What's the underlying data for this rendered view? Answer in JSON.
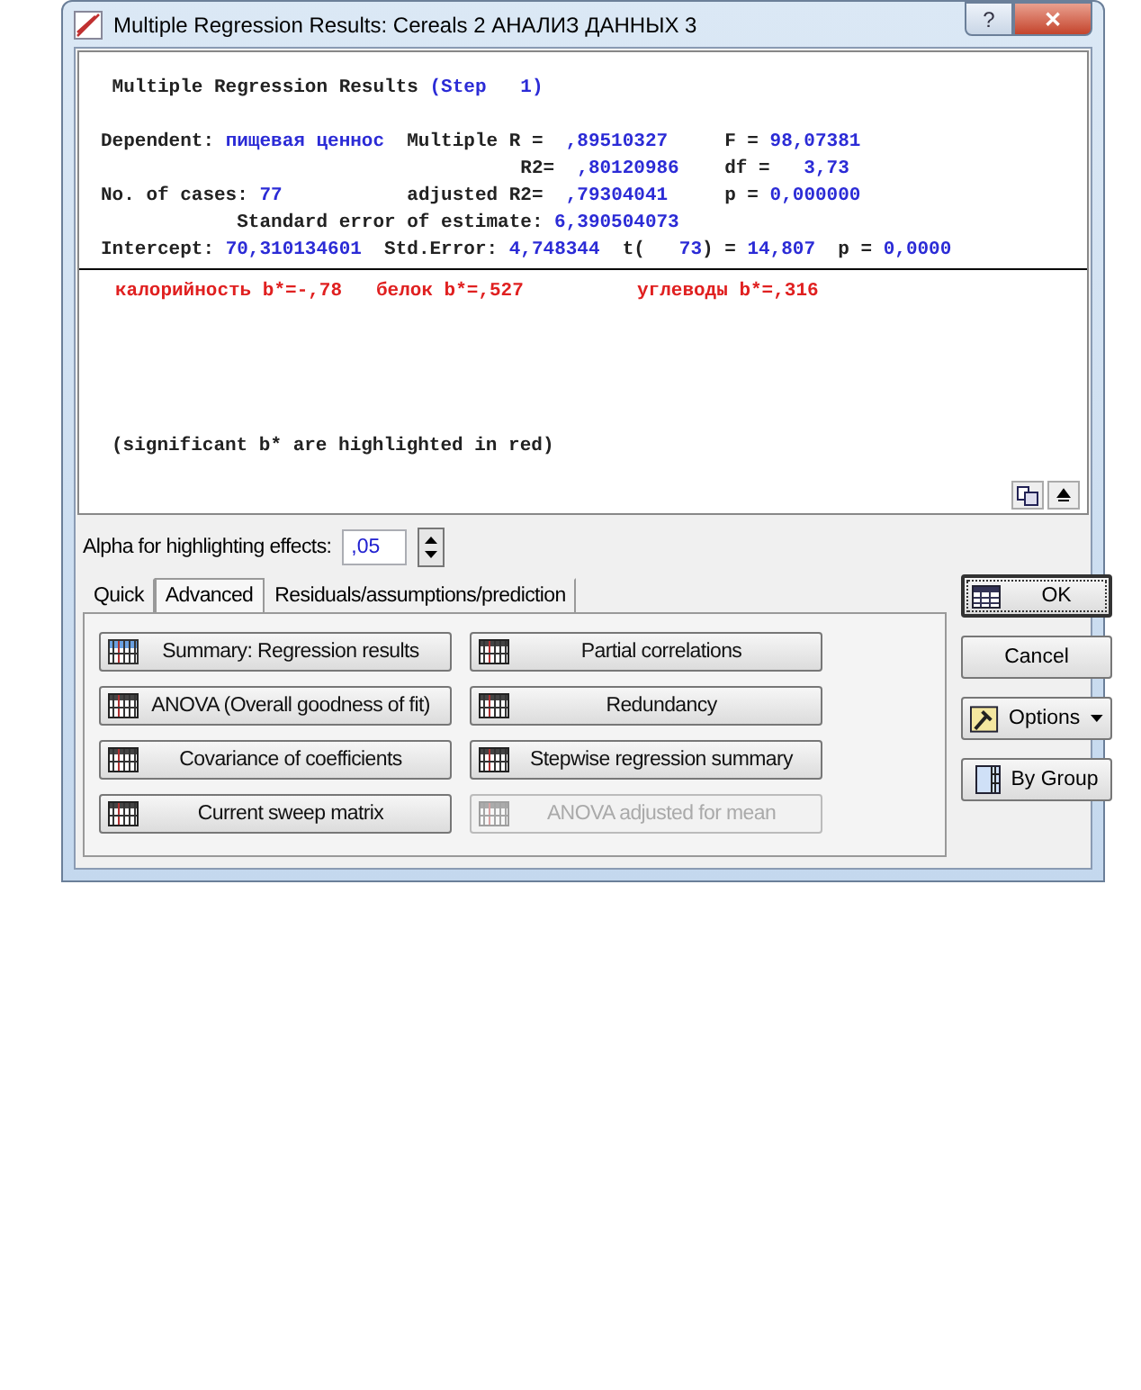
{
  "window": {
    "title": "Multiple Regression Results: Cereals 2 АНАЛИЗ ДАННЫХ 3",
    "buttons": [
      {
        "kind": "help",
        "label": "?"
      },
      {
        "kind": "close",
        "label": "✕"
      }
    ]
  },
  "results": {
    "lines": [
      [
        {
          "kind": "label",
          "text": " Multiple Regression Results "
        },
        {
          "kind": "value",
          "text": "(Step   1)"
        }
      ],
      [
        {
          "kind": "blank"
        }
      ],
      [
        {
          "kind": "label",
          "text": "Dependent: "
        },
        {
          "kind": "value",
          "text": "пищевая ценнос"
        },
        {
          "kind": "label",
          "text": "  Multiple R = "
        },
        {
          "kind": "value",
          "text": " ,89510327"
        },
        {
          "kind": "label",
          "text": "     F = "
        },
        {
          "kind": "value",
          "text": "98,07381"
        }
      ],
      [
        {
          "kind": "label",
          "text": "                                     R2= "
        },
        {
          "kind": "value",
          "text": " ,80120986"
        },
        {
          "kind": "label",
          "text": "    df = "
        },
        {
          "kind": "value",
          "text": "  3,73"
        }
      ],
      [
        {
          "kind": "label",
          "text": "No. of cases: "
        },
        {
          "kind": "value",
          "text": "77"
        },
        {
          "kind": "label",
          "text": "           adjusted R2= "
        },
        {
          "kind": "value",
          "text": " ,79304041"
        },
        {
          "kind": "label",
          "text": "     p = "
        },
        {
          "kind": "value",
          "text": "0,000000"
        }
      ],
      [
        {
          "kind": "label",
          "text": "            Standard error of estimate: "
        },
        {
          "kind": "value",
          "text": "6,390504073"
        }
      ],
      [
        {
          "kind": "label",
          "text": "Intercept: "
        },
        {
          "kind": "value",
          "text": "70,310134601"
        },
        {
          "kind": "label",
          "text": "  Std.Error: "
        },
        {
          "kind": "value",
          "text": "4,748344"
        },
        {
          "kind": "label",
          "text": "  t(   "
        },
        {
          "kind": "value",
          "text": "73"
        },
        {
          "kind": "label",
          "text": ") = "
        },
        {
          "kind": "value",
          "text": "14,807"
        },
        {
          "kind": "label",
          "text": "  p = "
        },
        {
          "kind": "value",
          "text": "0,0000"
        }
      ]
    ],
    "coefficients": [
      {
        "text": "калорийность b*=-,78",
        "significant": true
      },
      {
        "text": "белок b*=,527",
        "significant": true
      },
      {
        "text": "углеводы b*=,316",
        "significant": true
      }
    ],
    "note": "(significant b* are highlighted in red)"
  },
  "alpha": {
    "label": "Alpha for highlighting effects:",
    "value": ",05"
  },
  "tabs": [
    {
      "label": "Quick",
      "selected": false
    },
    {
      "label": "Advanced",
      "selected": true
    },
    {
      "label": "Residuals/assumptions/prediction",
      "selected": false
    }
  ],
  "actions": [
    {
      "label": "Summary:  Regression results",
      "kind": "summary",
      "disabled": false
    },
    {
      "label": "Partial correlations",
      "kind": "table",
      "disabled": false
    },
    {
      "label": "ANOVA (Overall goodness of fit)",
      "kind": "table",
      "disabled": false
    },
    {
      "label": "Redundancy",
      "kind": "table",
      "disabled": false
    },
    {
      "label": "Covariance of coefficients",
      "kind": "table",
      "disabled": false
    },
    {
      "label": "Stepwise regression summary",
      "kind": "table",
      "disabled": false
    },
    {
      "label": "Current sweep matrix",
      "kind": "table",
      "disabled": false
    },
    {
      "label": "ANOVA adjusted for mean",
      "kind": "table",
      "disabled": true
    }
  ],
  "side_buttons": [
    {
      "kind": "ok",
      "label": "OK"
    },
    {
      "kind": "cancel",
      "label": "Cancel"
    },
    {
      "kind": "options",
      "label": "Options"
    },
    {
      "kind": "bygroup",
      "label": "By Group"
    }
  ]
}
